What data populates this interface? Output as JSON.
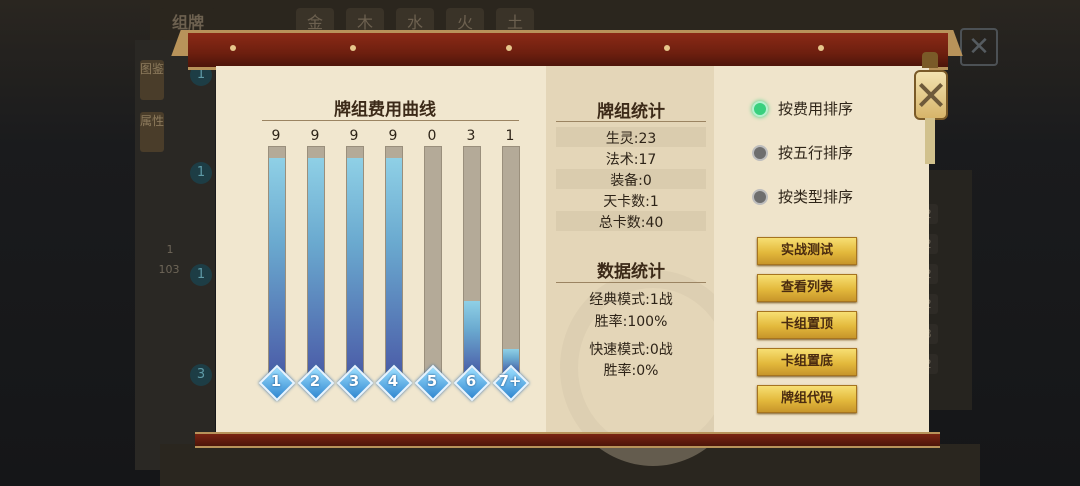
{
  "background": {
    "title": "组牌",
    "tabs": [
      "金",
      "木",
      "水",
      "火",
      "土"
    ],
    "left_tags": [
      "图鉴",
      "属性"
    ],
    "circle_counts": [
      "1",
      "1",
      "1",
      "3"
    ],
    "left_numbers": [
      "1",
      "103"
    ],
    "right_numbers": [
      "2",
      "2",
      "2",
      "2",
      "3",
      "2"
    ]
  },
  "cost_curve": {
    "title": "牌组费用曲线",
    "costs": [
      "1",
      "2",
      "3",
      "4",
      "5",
      "6",
      "7+"
    ],
    "counts": [
      9,
      9,
      9,
      9,
      0,
      3,
      1
    ],
    "max": 9,
    "fill_color": "#6aa9cf"
  },
  "deck_stats": {
    "title": "牌组统计",
    "lines": [
      "生灵:23",
      "法术:17",
      "装备:0",
      "天卡数:1",
      "总卡数:40"
    ]
  },
  "data_stats": {
    "title": "数据统计",
    "lines": [
      "经典模式:1战",
      "胜率:100%",
      "快速模式:0战",
      "胜率:0%"
    ]
  },
  "sort_options": [
    {
      "label": "按费用排序",
      "selected": true
    },
    {
      "label": "按五行排序",
      "selected": false
    },
    {
      "label": "按类型排序",
      "selected": false
    }
  ],
  "buttons": [
    "实战测试",
    "查看列表",
    "卡组置顶",
    "卡组置底",
    "牌组代码"
  ],
  "colors": {
    "frame": "#6d1f0f",
    "gold_button": "#e3b93c",
    "radio_on": "#39d07e"
  }
}
